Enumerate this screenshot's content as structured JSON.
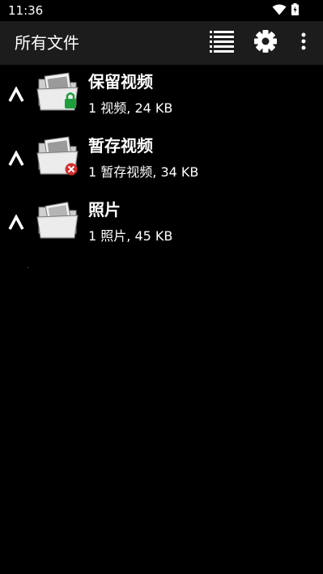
{
  "status_bar": {
    "time": "11:36",
    "icons": [
      "wifi-icon",
      "battery-charging-icon"
    ]
  },
  "app_bar": {
    "title": "所有文件",
    "actions": [
      {
        "name": "list-view-icon"
      },
      {
        "name": "settings-gear-icon"
      },
      {
        "name": "more-vertical-icon"
      }
    ]
  },
  "files": [
    {
      "title": "保留视频",
      "subtitle": "1 视频, 24 KB",
      "badge": "lock",
      "badge_color": "#1e9e3a"
    },
    {
      "title": "暂存视频",
      "subtitle": "1 暂存视频, 34 KB",
      "badge": "delete",
      "badge_color": "#d32f2f"
    },
    {
      "title": "照片",
      "subtitle": "1 照片, 45 KB",
      "badge": "none"
    }
  ],
  "colors": {
    "background": "#000000",
    "app_bar": "#1c1c1c",
    "text": "#ffffff"
  }
}
